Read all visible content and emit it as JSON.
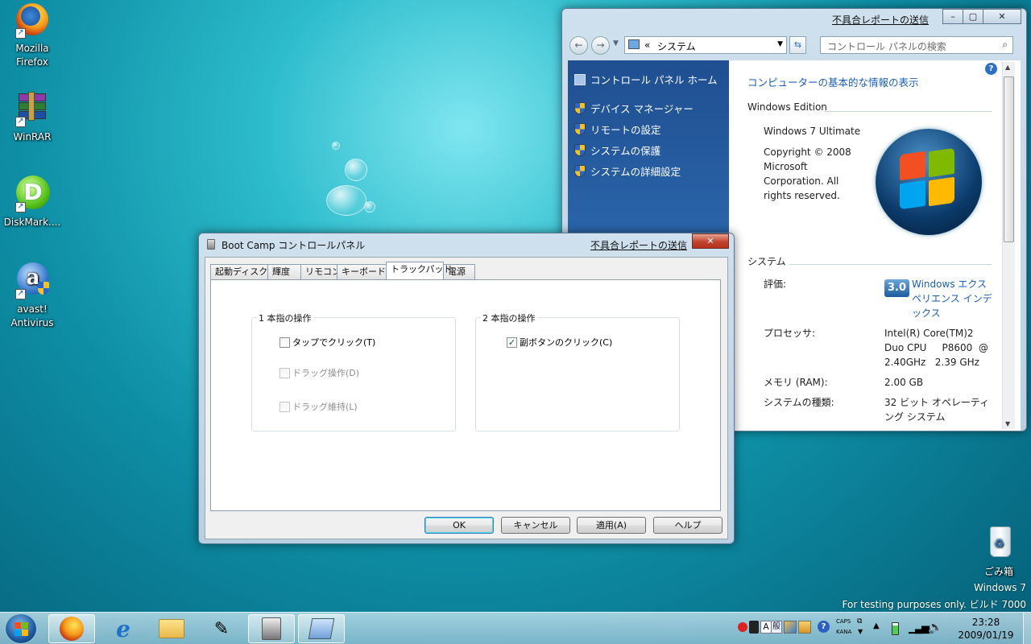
{
  "desktop": {
    "icons": [
      {
        "line1": "Mozilla",
        "line2": "Firefox"
      },
      {
        "line1": "WinRAR",
        "line2": ""
      },
      {
        "line1": "DiskMark....",
        "line2": ""
      },
      {
        "line1": "avast!",
        "line2": "Antivirus"
      }
    ],
    "recycle_bin": "ごみ箱",
    "watermark_line1": "Windows  7",
    "watermark_line2": "For testing purposes only. ビルド 7000"
  },
  "system_window": {
    "feedback_link": "不具合レポートの送信",
    "address_prefix": "«",
    "address_text": "システム",
    "search_placeholder": "コントロール パネルの検索",
    "left_home": "コントロール パネル ホーム",
    "left_items": [
      "デバイス マネージャー",
      "リモートの設定",
      "システムの保護",
      "システムの詳細設定"
    ],
    "main_title": "コンピューターの基本的な情報の表示",
    "edition_header": "Windows Edition",
    "edition_name": "Windows 7 Ultimate",
    "copyright": [
      "Copyright © 2008",
      "Microsoft",
      "Corporation.  All",
      "rights reserved."
    ],
    "system_header": "システム",
    "rows": [
      {
        "label": "評価:",
        "value": [
          "Windows エクス",
          "ペリエンス インデ",
          "ックス"
        ],
        "is_link": true
      },
      {
        "label": "プロセッサ:",
        "value": [
          "Intel(R) Core(TM)2",
          "Duo CPU     P8600  @",
          "2.40GHz   2.39 GHz"
        ],
        "is_link": false
      },
      {
        "label": "メモリ (RAM):",
        "value": [
          "2.00 GB"
        ],
        "is_link": false
      },
      {
        "label": "システムの種類:",
        "value": [
          "32 ビット オペレーティ",
          "ング システム"
        ],
        "is_link": false
      }
    ],
    "rating_badge": "3.0",
    "colors": {
      "link": "#1a5fb4",
      "left_panel": "#2d6ab0"
    }
  },
  "bootcamp": {
    "title": "Boot Camp コントロールパネル",
    "feedback_link": "不具合レポートの送信",
    "close_label": "✕",
    "tabs": [
      "起動ディスク",
      "輝度",
      "リモコン",
      "キーボード",
      "トラックパッド",
      "電源"
    ],
    "selected_tab": "トラックパッド",
    "group1_title": "1 本指の操作",
    "group1_items": [
      {
        "label": "タップでクリック(T)",
        "checked": false,
        "disabled": false
      },
      {
        "label": "ドラッグ操作(D)",
        "checked": false,
        "disabled": true
      },
      {
        "label": "ドラッグ維持(L)",
        "checked": false,
        "disabled": true
      }
    ],
    "group2_title": "2 本指の操作",
    "group2_items": [
      {
        "label": "副ボタンのクリック(C)",
        "checked": true,
        "disabled": false
      }
    ],
    "buttons": {
      "ok": "OK",
      "cancel": "キャンセル",
      "apply": "適用(A)",
      "help": "ヘルプ"
    }
  },
  "taskbar": {
    "caps": "CAPS",
    "kana": "KANA",
    "ime_a": "A",
    "ime_mode": "般",
    "time": "23:28",
    "date": "2009/01/19"
  }
}
